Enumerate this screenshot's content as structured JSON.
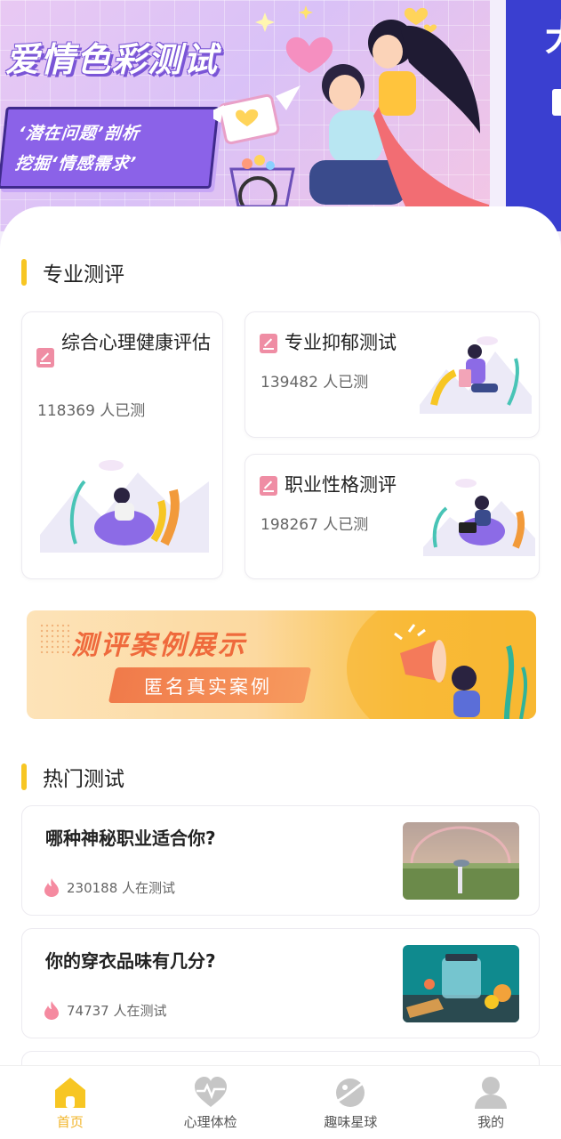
{
  "banner": {
    "title": "爱情色彩测试",
    "subtitle_line1": "‘潜在问题’剖析",
    "subtitle_line2": "挖掘‘情感需求’",
    "next_title": "大",
    "colors": {
      "bg": "#d9c1f7",
      "accent": "#8b62e8"
    }
  },
  "professional": {
    "section_title": "专业测评",
    "cards": [
      {
        "title": "综合心理健康评估",
        "count": "118369 人已测"
      },
      {
        "title": "专业抑郁测试",
        "count": "139482 人已测"
      },
      {
        "title": "职业性格测评",
        "count": "198267 人已测"
      }
    ]
  },
  "promo": {
    "title": "测评案例展示",
    "tag": "匿名真实案例"
  },
  "hot": {
    "section_title": "热门测试",
    "items": [
      {
        "title": "哪种神秘职业适合你?",
        "count": "230188 人在测试"
      },
      {
        "title": "你的穿衣品味有几分?",
        "count": "74737 人在测试"
      }
    ]
  },
  "nav": {
    "items": [
      {
        "label": "首页",
        "icon": "home-icon",
        "active": true
      },
      {
        "label": "心理体检",
        "icon": "heartbeat-icon",
        "active": false
      },
      {
        "label": "趣味星球",
        "icon": "planet-icon",
        "active": false
      },
      {
        "label": "我的",
        "icon": "user-icon",
        "active": false
      }
    ],
    "active_color": "#f2b52a",
    "inactive_color": "#c6c6c6"
  }
}
